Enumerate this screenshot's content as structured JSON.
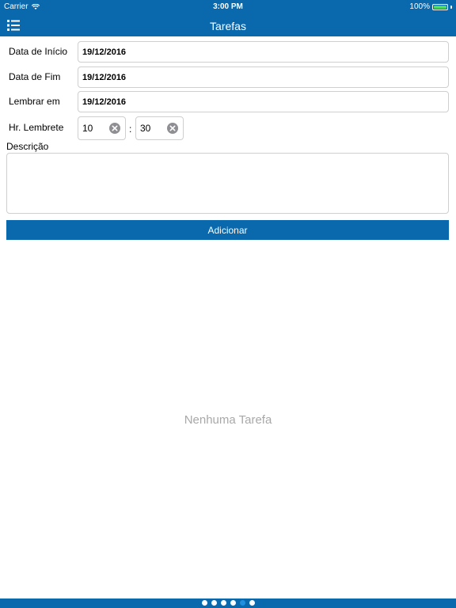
{
  "status_bar": {
    "carrier": "Carrier",
    "time": "3:00 PM",
    "battery": "100%"
  },
  "nav": {
    "title": "Tarefas",
    "menu_icon": "list-icon"
  },
  "form": {
    "start_label": "Data de Início",
    "start_value": "19/12/2016",
    "end_label": "Data de Fim",
    "end_value": "19/12/2016",
    "remind_label": "Lembrar em",
    "remind_value": "19/12/2016",
    "hour_label": "Hr. Lembrete",
    "hour_value": "10",
    "separator": ":",
    "minute_value": "30",
    "description_label": "Descrição",
    "description_value": ""
  },
  "add_button": "Adicionar",
  "empty_text": "Nenhuma Tarefa",
  "page_dots": {
    "count": 6,
    "active_index": 4
  },
  "colors": {
    "primary": "#0a68ad",
    "active_dot": "#1f8fe0",
    "muted_text": "#a8a8a8"
  }
}
